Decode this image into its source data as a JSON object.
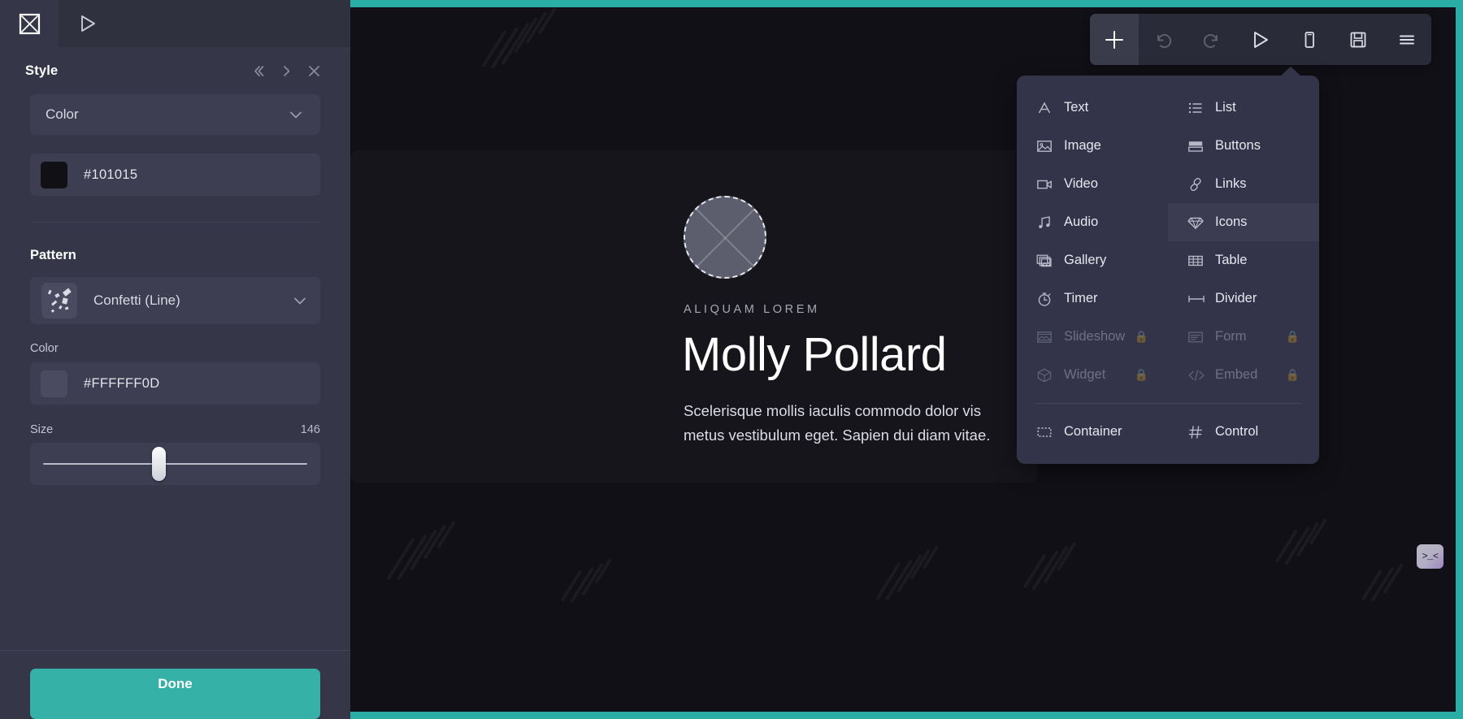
{
  "left_panel": {
    "tabs": [
      {
        "name": "placeholder-tab",
        "icon": "square-x-icon",
        "active": true
      },
      {
        "name": "play-tab",
        "icon": "play-icon",
        "active": false
      }
    ],
    "header": {
      "title": "Style",
      "prev_icon": "double-chevron-left-icon",
      "next_icon": "chevron-right-icon",
      "close_icon": "close-icon"
    },
    "style": {
      "type_select": {
        "value": "Color",
        "chevron": "chevron-down-icon"
      },
      "color_field": {
        "value": "#101015",
        "swatch": "#101015"
      }
    },
    "pattern": {
      "section_title": "Pattern",
      "select": {
        "value": "Confetti (Line)",
        "chevron": "chevron-down-icon"
      },
      "color_label": "Color",
      "color_field": {
        "value": "#FFFFFF0D",
        "swatch": "#4a4b60"
      },
      "size_label": "Size",
      "size_value": "146"
    },
    "footer": {
      "done_label": "Done"
    }
  },
  "toolbar": {
    "buttons": [
      {
        "label": "Add",
        "icon": "plus-icon",
        "active": true,
        "disabled": false
      },
      {
        "label": "Undo",
        "icon": "undo-icon",
        "active": false,
        "disabled": true
      },
      {
        "label": "Redo",
        "icon": "redo-icon",
        "active": false,
        "disabled": true
      },
      {
        "label": "Preview",
        "icon": "play-icon",
        "active": false,
        "disabled": false
      },
      {
        "label": "Mobile",
        "icon": "mobile-icon",
        "active": false,
        "disabled": false
      },
      {
        "label": "Save",
        "icon": "save-icon",
        "active": false,
        "disabled": false
      },
      {
        "label": "Menu",
        "icon": "hamburger-icon",
        "active": false,
        "disabled": false
      }
    ]
  },
  "add_menu": {
    "items": [
      {
        "label": "Text",
        "icon": "text-icon",
        "locked": false,
        "hover": false
      },
      {
        "label": "List",
        "icon": "list-icon",
        "locked": false,
        "hover": false
      },
      {
        "label": "Image",
        "icon": "image-icon",
        "locked": false,
        "hover": false
      },
      {
        "label": "Buttons",
        "icon": "buttons-icon",
        "locked": false,
        "hover": false
      },
      {
        "label": "Video",
        "icon": "video-icon",
        "locked": false,
        "hover": false
      },
      {
        "label": "Links",
        "icon": "links-icon",
        "locked": false,
        "hover": false
      },
      {
        "label": "Audio",
        "icon": "audio-icon",
        "locked": false,
        "hover": false
      },
      {
        "label": "Icons",
        "icon": "diamond-icon",
        "locked": false,
        "hover": true
      },
      {
        "label": "Gallery",
        "icon": "gallery-icon",
        "locked": false,
        "hover": false
      },
      {
        "label": "Table",
        "icon": "table-icon",
        "locked": false,
        "hover": false
      },
      {
        "label": "Timer",
        "icon": "timer-icon",
        "locked": false,
        "hover": false
      },
      {
        "label": "Divider",
        "icon": "divider-icon",
        "locked": false,
        "hover": false
      },
      {
        "label": "Slideshow",
        "icon": "slideshow-icon",
        "locked": true,
        "hover": false
      },
      {
        "label": "Form",
        "icon": "form-icon",
        "locked": true,
        "hover": false
      },
      {
        "label": "Widget",
        "icon": "widget-icon",
        "locked": true,
        "hover": false
      },
      {
        "label": "Embed",
        "icon": "embed-icon",
        "locked": true,
        "hover": false
      }
    ],
    "footer_items": [
      {
        "label": "Container",
        "icon": "container-icon",
        "locked": false
      },
      {
        "label": "Control",
        "icon": "hash-icon",
        "locked": false
      }
    ],
    "lock_glyph": "🔒"
  },
  "canvas": {
    "avatar": {
      "icon": "image-placeholder-avatar"
    },
    "eyebrow": "ALIQUAM LOREM",
    "headline": "Molly Pollard",
    "body": "Scelerisque mollis iaculis commodo dolor vis metus vestibulum eget. Sapien dui diam vitae.",
    "badge": ">_<",
    "accent_color": "#2aada4",
    "background_color": "#101015"
  }
}
